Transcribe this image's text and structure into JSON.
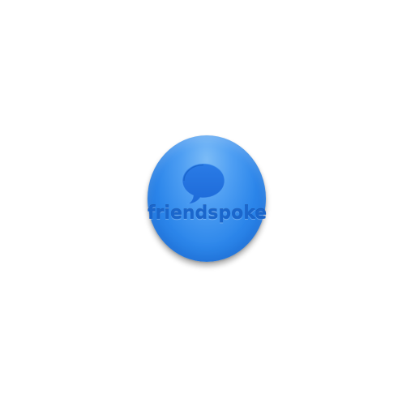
{
  "app_icon": {
    "brand_name": "friendspoke",
    "icon": "chat-bubble-icon",
    "colors": {
      "badge_top": "#7cbcf7",
      "badge_bottom": "#1f78e2",
      "emboss": "#1a66cc",
      "background": "#ffffff"
    }
  }
}
